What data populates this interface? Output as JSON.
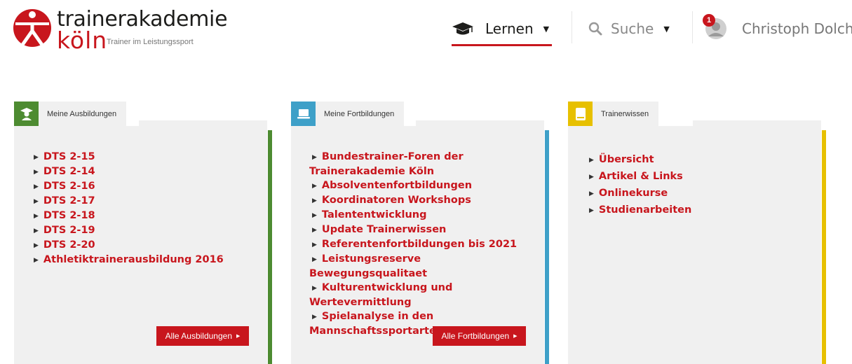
{
  "logo": {
    "name_line1": "trainerakademie",
    "name_line2": "köln",
    "tagline": "Trainer im Leistungssport"
  },
  "nav": {
    "lernen": "Lernen",
    "suche": "Suche",
    "caret": "▼",
    "user_name": "Christoph Dolch",
    "notification_count": "1"
  },
  "colors": {
    "brand_red": "#c8161d",
    "green": "#4d8b31",
    "blue": "#3ea0c8",
    "yellow": "#e7c000"
  },
  "panels": [
    {
      "title": "Meine Ausbildungen",
      "icon": "graduate-icon",
      "items": [
        "DTS 2-15",
        "DTS 2-14",
        "DTS 2-16",
        "DTS 2-17",
        "DTS 2-18",
        "DTS 2-19",
        "DTS 2-20",
        "Athletiktrainerausbildung 2016"
      ],
      "button": "Alle Ausbildungen"
    },
    {
      "title": "Meine Fortbildungen",
      "icon": "laptop-icon",
      "items": [
        "Bundestrainer-Foren der Trainerakademie Köln",
        "Absolventenfortbildungen",
        "Koordinatoren Workshops",
        "Talententwicklung",
        "Update Trainerwissen",
        "Referentenfortbildungen bis 2021",
        "Leistungsreserve Bewegungsqualitaet",
        "Kulturentwicklung und Wertevermittlung",
        "Spielanalyse in den Mannschaftssportarten"
      ],
      "button": "Alle Fortbildungen"
    },
    {
      "title": "Trainerwissen",
      "icon": "book-icon",
      "items": [
        "Übersicht",
        "Artikel & Links",
        "Onlinekurse",
        "Studienarbeiten"
      ]
    }
  ]
}
